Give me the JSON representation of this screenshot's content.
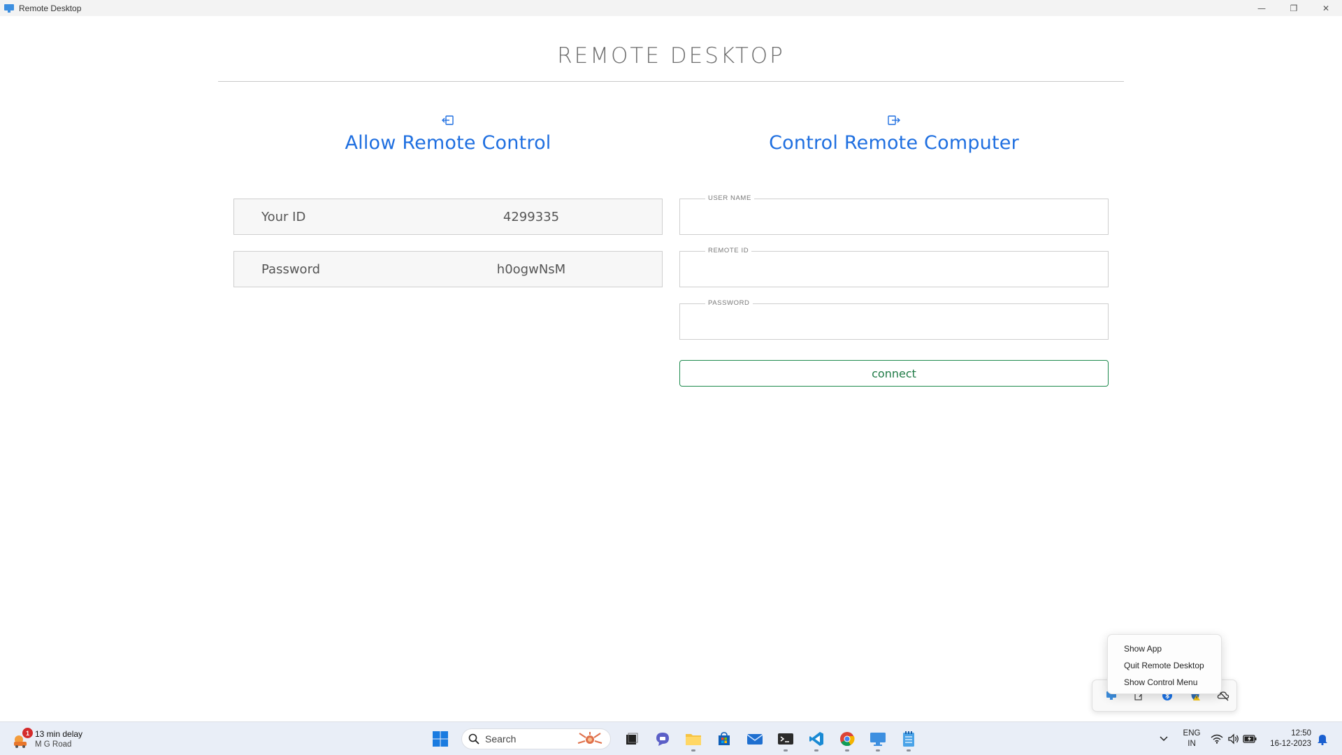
{
  "window": {
    "title": "Remote Desktop",
    "controls": {
      "minimize": "—",
      "restore": "❐",
      "close": "✕"
    }
  },
  "header": {
    "title": "REMOTE DESKTOP"
  },
  "allow": {
    "heading": "Allow Remote Control",
    "icon": "login-arrow-icon",
    "your_id_label": "Your ID",
    "your_id_value": "4299335",
    "password_label": "Password",
    "password_value": "h0ogwNsM"
  },
  "control": {
    "heading": "Control Remote Computer",
    "icon": "logout-arrow-icon",
    "user_name_legend": "USER NAME",
    "user_name_value": "",
    "remote_id_legend": "REMOTE ID",
    "remote_id_value": "",
    "password_legend": "PASSWORD",
    "password_value": "",
    "connect_label": "connect"
  },
  "context_menu": {
    "items": [
      "Show App",
      "Quit Remote Desktop",
      "Show Control Menu"
    ]
  },
  "taskbar": {
    "weather": {
      "badge": "1",
      "line1": "13 min delay",
      "line2": "M G Road"
    },
    "search_label": "Search",
    "language": {
      "line1": "ENG",
      "line2": "IN"
    },
    "clock": {
      "time": "12:50",
      "date": "16-12-2023"
    }
  },
  "colors": {
    "accent_blue": "#1f6fe0",
    "connect_green": "#1e8a4e",
    "taskbar_bg": "#e9eef7"
  }
}
